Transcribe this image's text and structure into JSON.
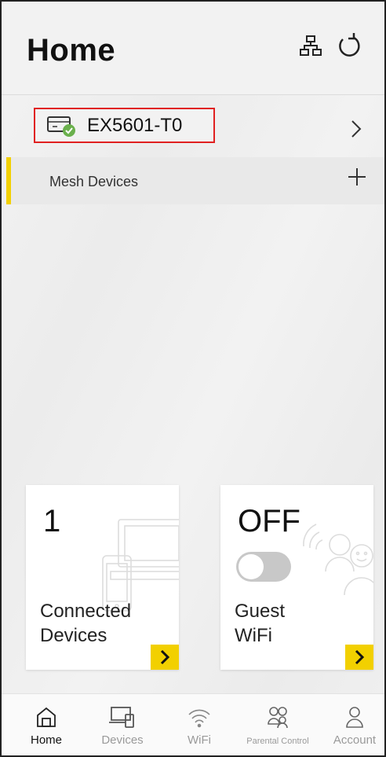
{
  "header": {
    "title": "Home",
    "topology_icon": "network-topology-icon",
    "refresh_icon": "refresh-icon"
  },
  "device": {
    "name": "EX5601-T0",
    "icon": "router-online-icon",
    "chevron_icon": "chevron-right-icon"
  },
  "mesh": {
    "label": "Mesh Devices",
    "add_icon": "plus-icon"
  },
  "cards": {
    "connected": {
      "value": "1",
      "label_line1": "Connected",
      "label_line2": "Devices",
      "arrow_icon": "chevron-right-icon"
    },
    "guest": {
      "value": "OFF",
      "label_line1": "Guest",
      "label_line2": "WiFi",
      "toggle_on": false,
      "arrow_icon": "chevron-right-icon"
    }
  },
  "nav": {
    "items": [
      {
        "label": "Home",
        "icon": "home-icon",
        "active": true
      },
      {
        "label": "Devices",
        "icon": "devices-icon",
        "active": false
      },
      {
        "label": "WiFi",
        "icon": "wifi-icon",
        "active": false
      },
      {
        "label": "Parental Control",
        "icon": "parental-control-icon",
        "active": false
      },
      {
        "label": "Account",
        "icon": "account-icon",
        "active": false
      }
    ]
  },
  "colors": {
    "accent": "#f2d000",
    "highlight_box": "#e02020",
    "status_ok": "#6ab04c"
  }
}
